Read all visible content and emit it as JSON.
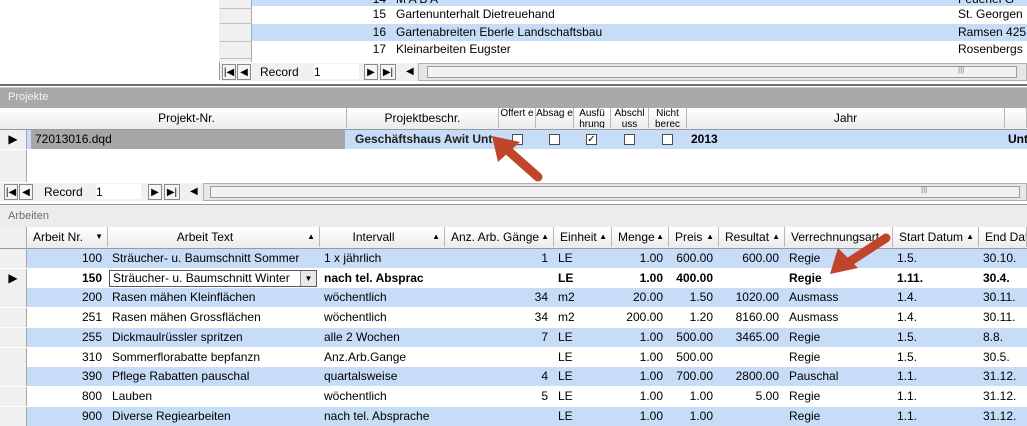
{
  "top_list": {
    "rows": [
      {
        "num": "14",
        "name": "M A B A",
        "right": "Feuerlei G"
      },
      {
        "num": "15",
        "name": "Gartenunterhalt Dietreuehand",
        "right": "St. Georgen"
      },
      {
        "num": "16",
        "name": "Gartenabreiten Eberle Landschaftsbau",
        "right": "Ramsen 425"
      },
      {
        "num": "17",
        "name": "Kleinarbeiten Eugster",
        "right": "Rosenbergs"
      }
    ],
    "nav": {
      "label": "Record",
      "value": "1",
      "first": "|◀",
      "prev": "◀",
      "next": "▶",
      "last": "▶|",
      "new": "▶*"
    }
  },
  "projekte": {
    "section_title": "Projekte",
    "headers": {
      "projekt_nr": "Projekt-Nr.",
      "projektbeschr": "Projektbeschr.",
      "offerte": "Offert e",
      "absage": "Absag e",
      "ausfuehrung": "Ausfü hrung",
      "abschluss": "Abschl uss",
      "nicht_berechnet": "Nicht berec",
      "jahr": "Jahr"
    },
    "row": {
      "projekt_nr": "72013016.dqd",
      "projektbeschr": "Geschäftshaus Awit Unt",
      "offerte": false,
      "absage": false,
      "ausfuehrung": true,
      "abschluss": false,
      "nicht_berechnet": false,
      "jahr": "2013",
      "extra": "Unt"
    },
    "nav": {
      "label": "Record",
      "value": "1"
    }
  },
  "arbeiten": {
    "section_title": "Arbeiten",
    "headers": [
      "Arbeit Nr.",
      "Arbeit Text",
      "Intervall",
      "Anz. Arb. Gänge",
      "Einheit",
      "Menge",
      "Preis",
      "Resultat",
      "Verrechnungsart",
      "Start Datum",
      "End Datu"
    ],
    "rows": [
      {
        "nr": "100",
        "text": "Sträucher- u. Baumschnitt Sommer",
        "intervall": "1 x jährlich",
        "anz": "1",
        "einheit": "LE",
        "menge": "1.00",
        "preis": "600.00",
        "resultat": "600.00",
        "verrechnung": "Regie",
        "start": "1.5.",
        "end": "30.10."
      },
      {
        "nr": "150",
        "text": "Sträucher- u. Baumschnitt Winter",
        "intervall": "nach tel. Absprac",
        "anz": "",
        "einheit": "LE",
        "menge": "1.00",
        "preis": "400.00",
        "resultat": "",
        "verrechnung": "Regie",
        "start": "1.11.",
        "end": "30.4."
      },
      {
        "nr": "200",
        "text": "Rasen mähen Kleinflächen",
        "intervall": "wöchentlich",
        "anz": "34",
        "einheit": "m2",
        "menge": "20.00",
        "preis": "1.50",
        "resultat": "1020.00",
        "verrechnung": "Ausmass",
        "start": "1.4.",
        "end": "30.11."
      },
      {
        "nr": "251",
        "text": "Rasen mähen Grossflächen",
        "intervall": "wöchentlich",
        "anz": "34",
        "einheit": "m2",
        "menge": "200.00",
        "preis": "1.20",
        "resultat": "8160.00",
        "verrechnung": "Ausmass",
        "start": "1.4.",
        "end": "30.11."
      },
      {
        "nr": "255",
        "text": "Dickmaulrüssler spritzen",
        "intervall": "alle 2 Wochen",
        "anz": "7",
        "einheit": "LE",
        "menge": "1.00",
        "preis": "500.00",
        "resultat": "3465.00",
        "verrechnung": "Regie",
        "start": "1.5.",
        "end": "8.8."
      },
      {
        "nr": "310",
        "text": "Sommerflorabatte bepfanzn",
        "intervall": "Anz.Arb.Gange",
        "anz": "",
        "einheit": "LE",
        "menge": "1.00",
        "preis": "500.00",
        "resultat": "",
        "verrechnung": "Regie",
        "start": "1.5.",
        "end": "30.5."
      },
      {
        "nr": "390",
        "text": "Pflege Rabatten pauschal",
        "intervall": "quartalsweise",
        "anz": "4",
        "einheit": "LE",
        "menge": "1.00",
        "preis": "700.00",
        "resultat": "2800.00",
        "verrechnung": "Pauschal",
        "start": "1.1.",
        "end": "31.12."
      },
      {
        "nr": "800",
        "text": "Lauben",
        "intervall": "wöchentlich",
        "anz": "5",
        "einheit": "LE",
        "menge": "1.00",
        "preis": "1.00",
        "resultat": "5.00",
        "verrechnung": "Regie",
        "start": "1.1.",
        "end": "31.12."
      },
      {
        "nr": "900",
        "text": "Diverse Regiearbeiten",
        "intervall": "nach tel. Absprache",
        "anz": "",
        "einheit": "LE",
        "menge": "1.00",
        "preis": "1.00",
        "resultat": "",
        "verrechnung": "Regie",
        "start": "1.1.",
        "end": "31.12."
      }
    ]
  },
  "icons": {
    "record_selector": "▶",
    "sort_up": "▲",
    "sort_down": "▼",
    "dropdown": "▼",
    "scroll_left": "◀",
    "scroll_grip": "|||",
    "arrow": "red-arrow-icon"
  },
  "colors": {
    "row_blue": "#c6dcf7",
    "arrow_red": "#c0452a",
    "section_bar": "#a9a9a9"
  }
}
